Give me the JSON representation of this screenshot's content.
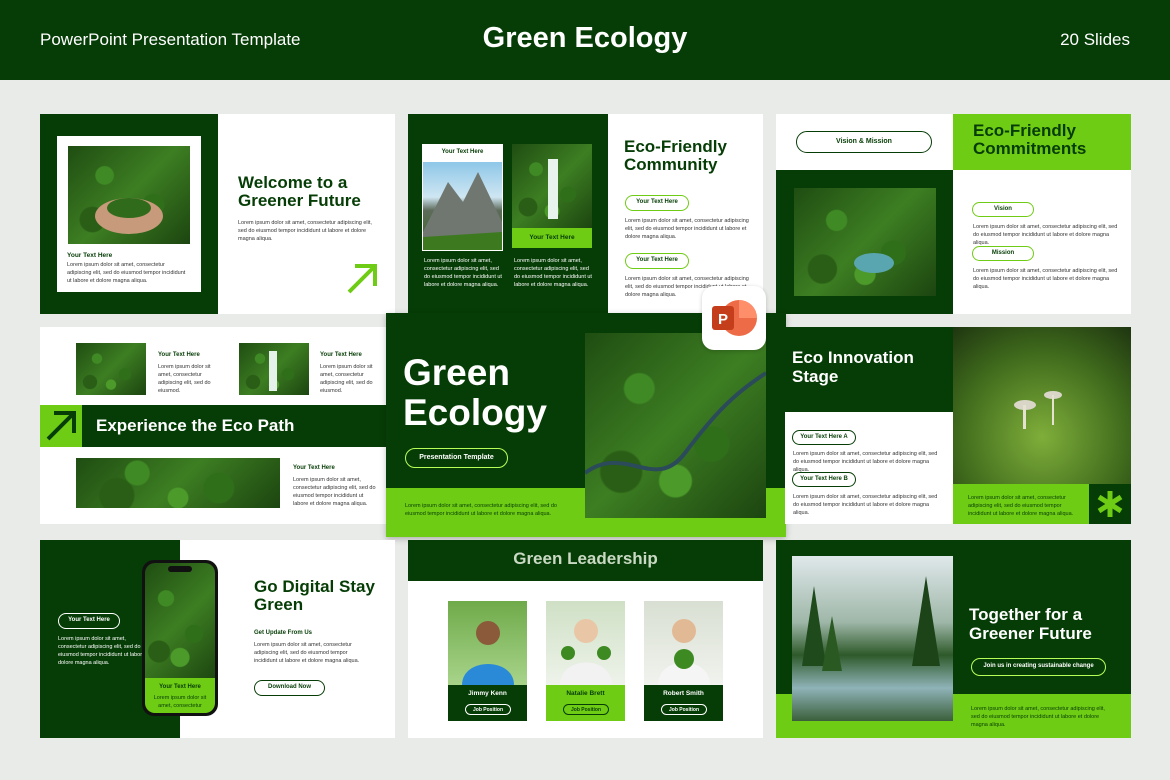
{
  "header": {
    "left": "PowerPoint Presentation Template",
    "title": "Green Ecology",
    "right": "20 Slides"
  },
  "lorem3": "Lorem ipsum dolor sit amet, consectetur adipiscing elit, sed do eiusmod tempor incididunt ut labore et dolore magna aliqua.",
  "lorem5": "Lorem ipsum dolor sit amet, consectetur adipiscing elit, sed do eiusmod tempor incididunt ut labore et dolore magna aliqua.",
  "s1": {
    "title": "Welcome to a Greener Future",
    "caption": "Your Text Here"
  },
  "s2": {
    "title": "Eco-Friendly Community",
    "card1": "Your Text Here",
    "card2": "Your Text Here",
    "btn1": "Your Text Here",
    "btn2": "Your Text Here"
  },
  "s3": {
    "tag": "Vision & Mission",
    "title": "Eco-Friendly Commitments",
    "vision": "Vision",
    "mission": "Mission"
  },
  "s4": {
    "label1": "Your Text Here",
    "label2": "Your Text Here",
    "label3": "Your Text Here",
    "banner": "Experience the Eco Path",
    "short": "Lorem ipsum dolor sit amet, consectetur adipiscing elit, sed do eiusmod."
  },
  "s5": {
    "title": "Green Ecology",
    "pill": "Presentation Template"
  },
  "s6": {
    "title": "Eco Innovation Stage",
    "a": "Your Text Here A",
    "b": "Your Text Here B"
  },
  "s7": {
    "title": "Go Digital Stay Green",
    "pill": "Your Text Here",
    "sub": "Get Update From Us",
    "download": "Download Now",
    "phone_label": "Your Text Here",
    "phone_text": "Lorem ipsum dolor sit amet, consectetur"
  },
  "s8": {
    "title": "Green Leadership",
    "people": [
      {
        "name": "Jimmy Kenn",
        "position": "Job Position"
      },
      {
        "name": "Natalie Brett",
        "position": "Job Position"
      },
      {
        "name": "Robert Smith",
        "position": "Job Position"
      }
    ]
  },
  "s9": {
    "title": "Together for a Greener Future",
    "pill": "Join us in creating sustainable change"
  },
  "colors": {
    "dark": "#063d06",
    "lime": "#6fcc14"
  }
}
